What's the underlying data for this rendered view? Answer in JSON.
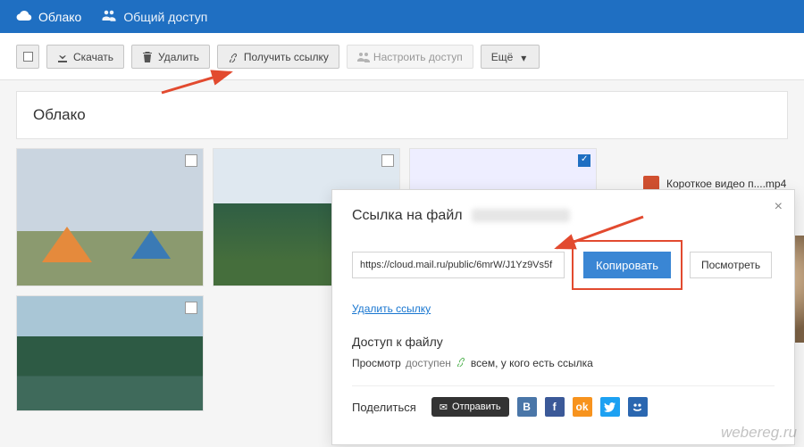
{
  "header": {
    "cloud_label": "Облако",
    "shared_label": "Общий доступ"
  },
  "toolbar": {
    "download": "Скачать",
    "delete": "Удалить",
    "get_link": "Получить ссылку",
    "configure_access": "Настроить доступ",
    "more": "Ещё"
  },
  "page_title": "Облако",
  "file_item": {
    "name": "Короткое видео п....mp4"
  },
  "popup": {
    "title": "Ссылка на файл",
    "link_value": "https://cloud.mail.ru/public/6mrW/J1Yz9Vs5f",
    "copy": "Копировать",
    "view": "Посмотреть",
    "delete_link": "Удалить ссылку",
    "access_title": "Доступ к файлу",
    "access_mode": "Просмотр",
    "access_available": "доступен",
    "access_everyone": "всем, у кого есть ссылка",
    "share_label": "Поделиться",
    "send": "Отправить"
  },
  "watermark": "webereg.ru",
  "colors": {
    "primary": "#1f6fc2",
    "accent_highlight": "#e24a2f"
  }
}
